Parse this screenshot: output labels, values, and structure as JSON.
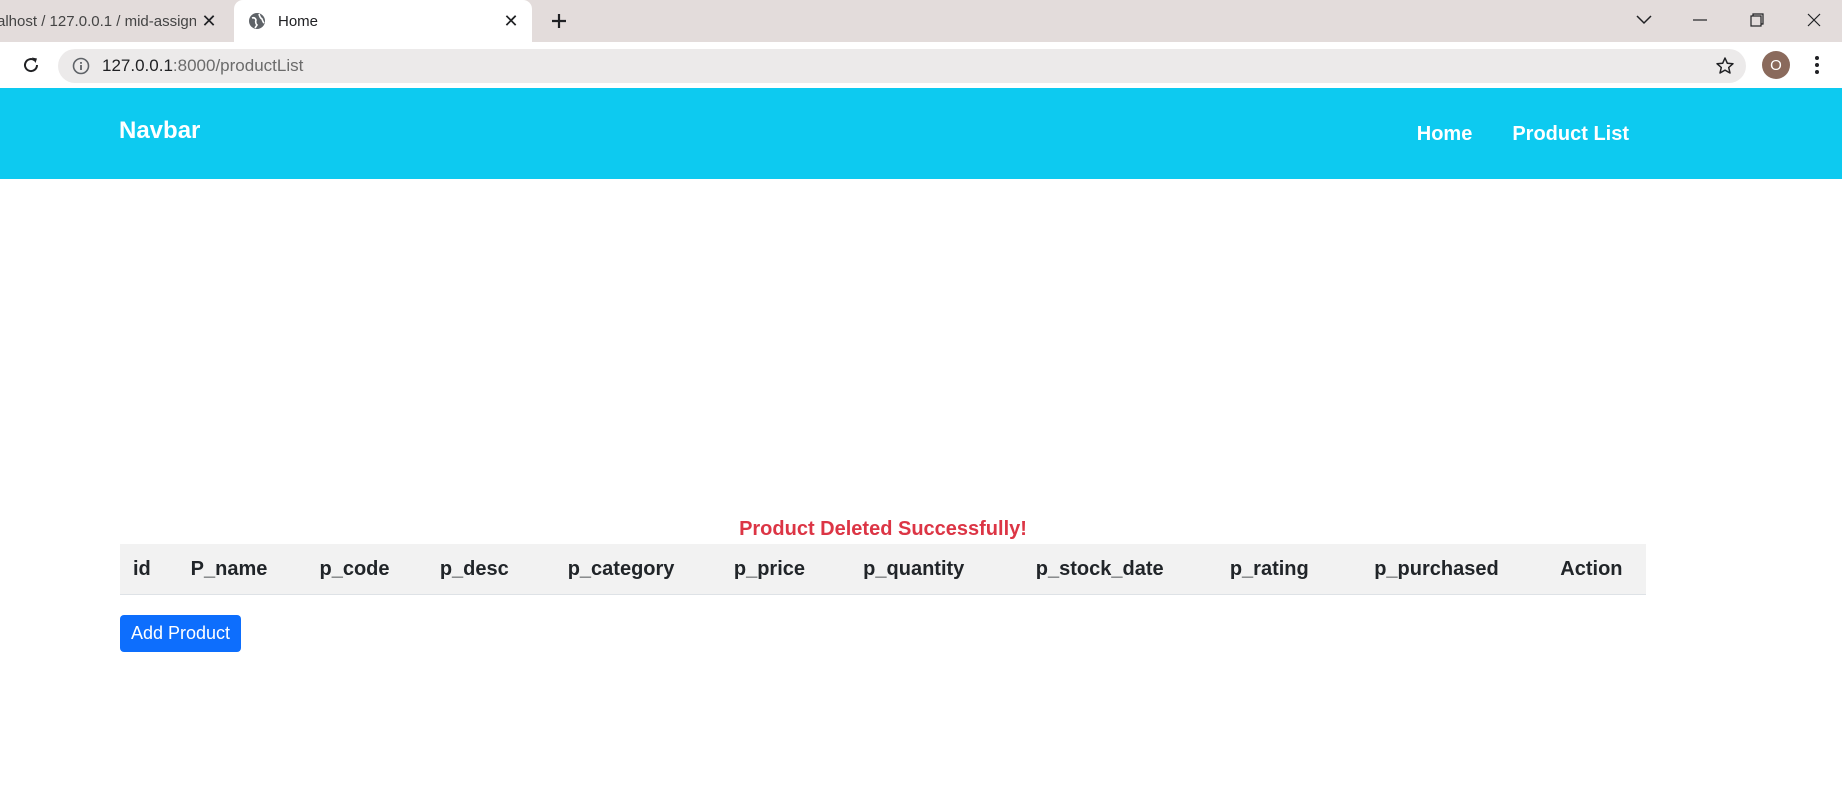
{
  "browser": {
    "tabs": [
      {
        "title": "alhost / 127.0.0.1 / mid-assign",
        "active": false
      },
      {
        "title": "Home",
        "active": true
      }
    ],
    "url_host": "127.0.0.1",
    "url_path": ":8000/productList",
    "profile_initial": "O"
  },
  "navbar": {
    "brand": "Navbar",
    "links": [
      "Home",
      "Product List"
    ],
    "color": "#0dcaf0"
  },
  "main": {
    "message": "Product Deleted Successfully!",
    "message_color": "#dc3545",
    "table": {
      "columns": [
        "id",
        "P_name",
        "p_code",
        "p_desc",
        "p_category",
        "p_price",
        "p_quantity",
        "p_stock_date",
        "p_rating",
        "p_purchased",
        "Action"
      ],
      "rows": []
    },
    "add_button": "Add Product",
    "add_button_color": "#0d6efd"
  }
}
